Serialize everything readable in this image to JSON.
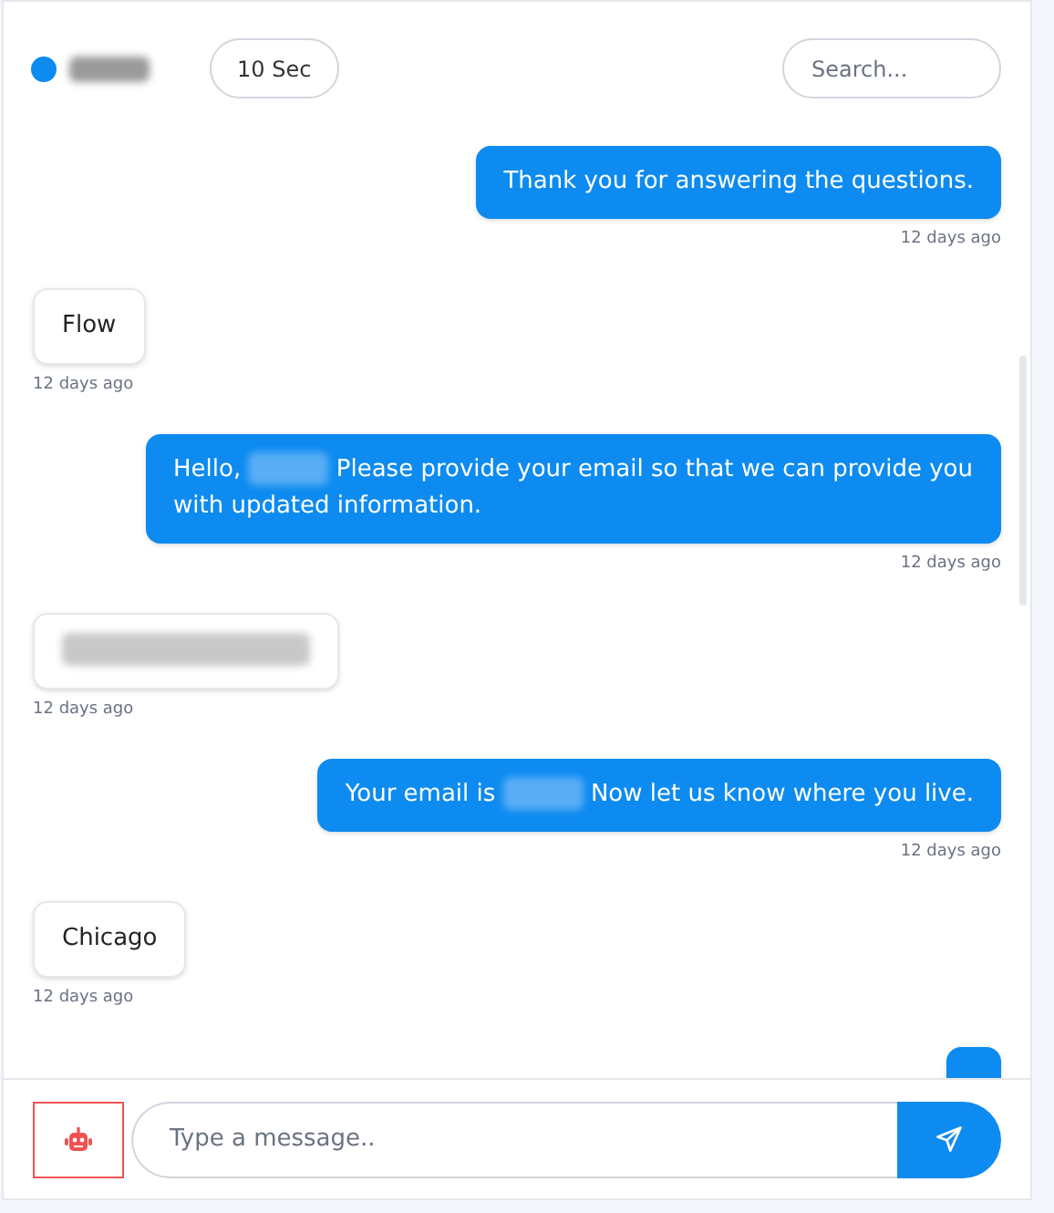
{
  "header": {
    "timer": "10 Sec",
    "search": {
      "placeholder": "Search..."
    }
  },
  "messages": [
    {
      "kind": "sent",
      "segments": [
        {
          "kind": "text",
          "text": "Thank you for answering the questions."
        }
      ],
      "time": "12 days ago"
    },
    {
      "kind": "received",
      "segments": [
        {
          "kind": "text",
          "text": "Flow"
        }
      ],
      "time": "12 days ago"
    },
    {
      "kind": "sent",
      "segments": [
        {
          "kind": "text",
          "text": "Hello,"
        },
        {
          "kind": "redacted"
        },
        {
          "kind": "text",
          "text": "Please provide your email so that we can provide you with updated information."
        }
      ],
      "time": "12 days ago"
    },
    {
      "kind": "received",
      "segments": [
        {
          "kind": "redacted"
        }
      ],
      "time": "12 days ago"
    },
    {
      "kind": "sent",
      "segments": [
        {
          "kind": "text",
          "text": "Your email is"
        },
        {
          "kind": "redacted"
        },
        {
          "kind": "text",
          "text": "Now let us know where you live."
        }
      ],
      "time": "12 days ago"
    },
    {
      "kind": "received",
      "segments": [
        {
          "kind": "text",
          "text": "Chicago"
        }
      ],
      "time": "12 days ago"
    },
    {
      "kind": "sent"
    }
  ],
  "composer": {
    "placeholder": "Type a message.."
  }
}
